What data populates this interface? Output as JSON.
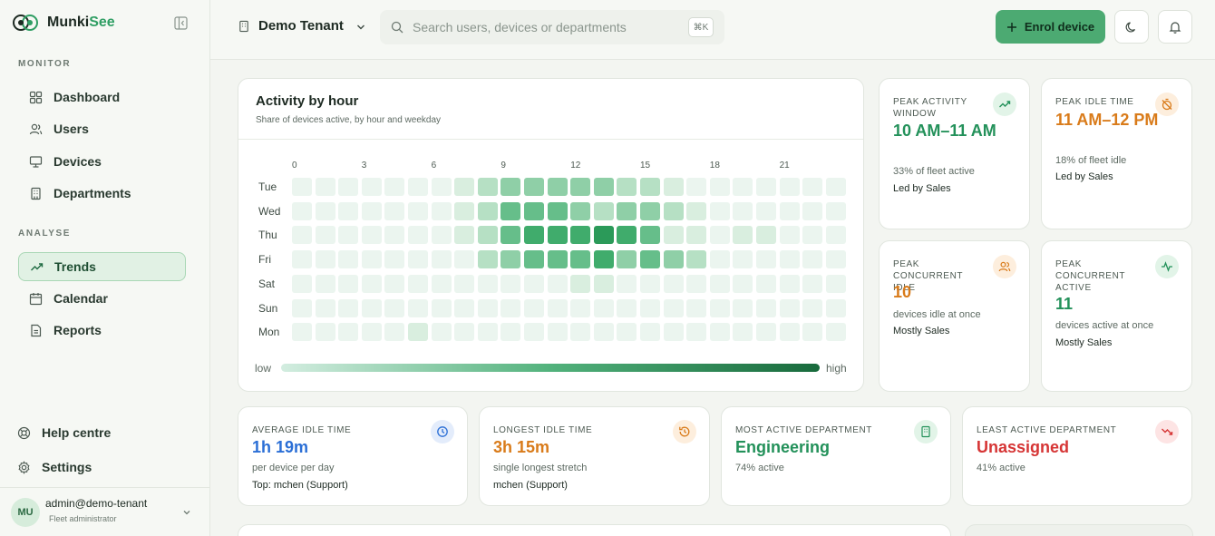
{
  "brand": {
    "name_prefix": "Munki",
    "name_suffix": "See"
  },
  "sidebar": {
    "monitor_label": "MONITOR",
    "analyse_label": "ANALYSE",
    "monitor_items": [
      {
        "label": "Dashboard",
        "icon": "dashboard-icon"
      },
      {
        "label": "Users",
        "icon": "users-icon"
      },
      {
        "label": "Devices",
        "icon": "monitor-icon"
      },
      {
        "label": "Departments",
        "icon": "building-icon"
      }
    ],
    "analyse_items": [
      {
        "label": "Trends",
        "icon": "trend-icon",
        "active": true
      },
      {
        "label": "Calendar",
        "icon": "calendar-icon"
      },
      {
        "label": "Reports",
        "icon": "document-icon"
      }
    ],
    "help_label": "Help centre",
    "settings_label": "Settings",
    "user": {
      "initials": "MU",
      "email": "admin@demo-tenant",
      "role": "Fleet administrator"
    }
  },
  "header": {
    "tenant": "Demo Tenant",
    "search_placeholder": "Search users, devices or departments",
    "search_shortcut": "⌘K",
    "enrol_label": "Enrol device"
  },
  "heatmap": {
    "title": "Activity by hour",
    "subtitle": "Share of devices active, by hour and weekday",
    "hour_labels": [
      {
        "hour": 0,
        "label": "0"
      },
      {
        "hour": 3,
        "label": "3"
      },
      {
        "hour": 6,
        "label": "6"
      },
      {
        "hour": 9,
        "label": "9"
      },
      {
        "hour": 12,
        "label": "12"
      },
      {
        "hour": 15,
        "label": "15"
      },
      {
        "hour": 18,
        "label": "18"
      },
      {
        "hour": 21,
        "label": "21"
      }
    ],
    "days": [
      "Tue",
      "Wed",
      "Thu",
      "Fri",
      "Sat",
      "Sun",
      "Mon"
    ],
    "levels": [
      [
        0,
        0,
        0,
        0,
        0,
        0,
        0,
        1,
        2,
        3,
        3,
        3,
        3,
        3,
        2,
        2,
        1,
        0,
        0,
        0,
        0,
        0,
        0,
        0
      ],
      [
        0,
        0,
        0,
        0,
        0,
        0,
        0,
        1,
        2,
        4,
        4,
        4,
        3,
        2,
        3,
        3,
        2,
        1,
        0,
        0,
        0,
        0,
        0,
        0
      ],
      [
        0,
        0,
        0,
        0,
        0,
        0,
        0,
        1,
        2,
        4,
        5,
        5,
        5,
        6,
        5,
        4,
        1,
        1,
        0,
        1,
        1,
        0,
        0,
        0
      ],
      [
        0,
        0,
        0,
        0,
        0,
        0,
        0,
        0,
        2,
        3,
        4,
        4,
        4,
        5,
        3,
        4,
        3,
        2,
        0,
        0,
        0,
        0,
        0,
        0
      ],
      [
        0,
        0,
        0,
        0,
        0,
        0,
        0,
        0,
        0,
        0,
        0,
        0,
        1,
        1,
        0,
        0,
        0,
        0,
        0,
        0,
        0,
        0,
        0,
        0
      ],
      [
        0,
        0,
        0,
        0,
        0,
        0,
        0,
        0,
        0,
        0,
        0,
        0,
        0,
        0,
        0,
        0,
        0,
        0,
        0,
        0,
        0,
        0,
        0,
        0
      ],
      [
        0,
        0,
        0,
        0,
        0,
        1,
        0,
        0,
        0,
        0,
        0,
        0,
        0,
        0,
        0,
        0,
        0,
        0,
        0,
        0,
        0,
        0,
        0,
        0
      ]
    ],
    "level_colors": [
      "#ebf5ef",
      "#d9eedf",
      "#b6e0c4",
      "#8fcfa7",
      "#66be8a",
      "#40ac6c",
      "#2b9a59"
    ],
    "legend_low": "low",
    "legend_high": "high"
  },
  "stats": {
    "peak_activity": {
      "label": "PEAK ACTIVITY WINDOW",
      "value": "10 AM–11 AM",
      "desc": "33% of fleet active",
      "extra": "Led by Sales"
    },
    "peak_idle": {
      "label": "PEAK IDLE TIME",
      "value": "11 AM–12 PM",
      "desc": "18% of fleet idle",
      "extra": "Led by Sales"
    },
    "peak_concurrent_idle": {
      "label": "PEAK CONCURRENT IDLE",
      "value": "10",
      "desc": "devices idle at once",
      "extra": "Mostly Sales"
    },
    "peak_concurrent_active": {
      "label": "PEAK CONCURRENT ACTIVE",
      "value": "11",
      "desc": "devices active at once",
      "extra": "Mostly Sales"
    },
    "avg_idle": {
      "label": "AVERAGE IDLE TIME",
      "value": "1h 19m",
      "desc": "per device per day",
      "extra": "Top: mchen (Support)"
    },
    "longest_idle": {
      "label": "LONGEST IDLE TIME",
      "value": "3h 15m",
      "desc": "single longest stretch",
      "extra": "mchen (Support)"
    },
    "most_active_dept": {
      "label": "MOST ACTIVE DEPARTMENT",
      "value": "Engineering",
      "desc": "74% active"
    },
    "least_active_dept": {
      "label": "LEAST ACTIVE DEPARTMENT",
      "value": "Unassigned",
      "desc": "41% active"
    }
  },
  "colors": {
    "accent": "#4caa72",
    "green": "#23915a",
    "orange": "#d97b1a",
    "blue": "#2b6fd6",
    "red": "#d63535"
  }
}
